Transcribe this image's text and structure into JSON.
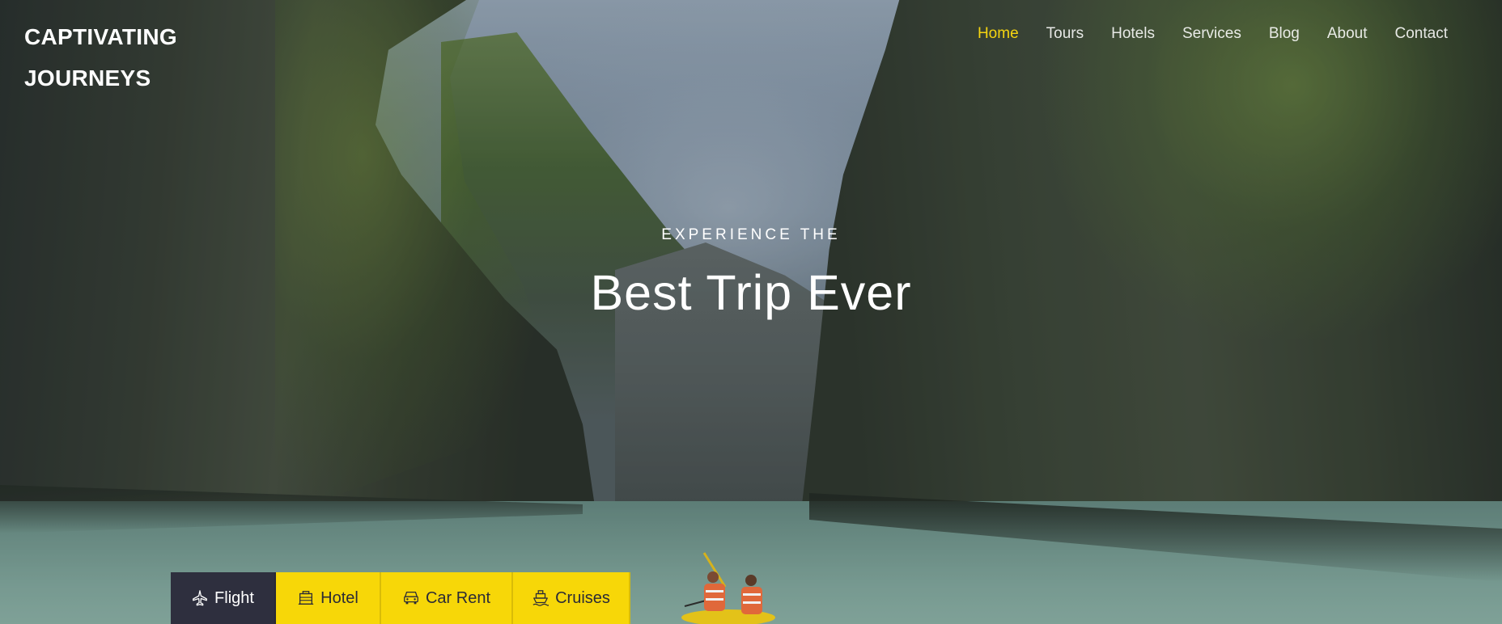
{
  "brand": {
    "line1": "CAPTIVATING",
    "line2": "JOURNEYS"
  },
  "nav": {
    "items": [
      {
        "label": "Home",
        "active": true
      },
      {
        "label": "Tours",
        "active": false
      },
      {
        "label": "Hotels",
        "active": false
      },
      {
        "label": "Services",
        "active": false
      },
      {
        "label": "Blog",
        "active": false
      },
      {
        "label": "About",
        "active": false
      },
      {
        "label": "Contact",
        "active": false
      }
    ],
    "active_color": "#f5d410"
  },
  "hero": {
    "subtitle": "EXPERIENCE THE",
    "title": "Best Trip Ever"
  },
  "booking_tabs": [
    {
      "label": "Flight",
      "icon": "plane-icon",
      "active": true
    },
    {
      "label": "Hotel",
      "icon": "hotel-icon",
      "active": false
    },
    {
      "label": "Car Rent",
      "icon": "car-icon",
      "active": false
    },
    {
      "label": "Cruises",
      "icon": "ship-icon",
      "active": false
    }
  ],
  "colors": {
    "accent": "#f7d708",
    "active_tab": "#2e2f3e"
  }
}
